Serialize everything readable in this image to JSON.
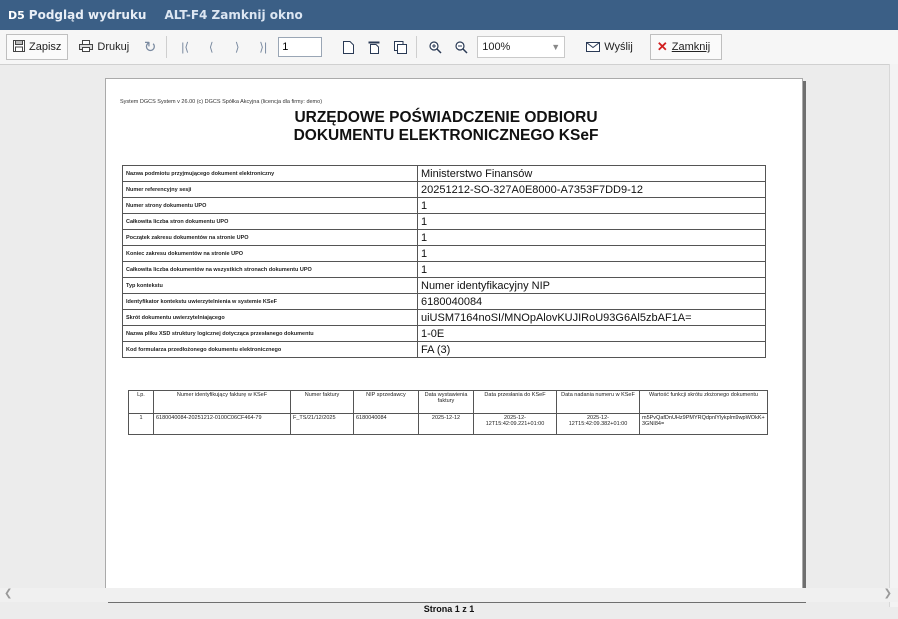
{
  "titlebar": {
    "logo": "D5",
    "title": "Podgląd wydruku",
    "hint": "ALT-F4 Zamknij okno"
  },
  "toolbar": {
    "save_label": "Zapisz",
    "print_label": "Drukuj",
    "page_value": "1",
    "zoom_value": "100%",
    "send_label": "Wyślij",
    "close_label": "Zamknij"
  },
  "document": {
    "system_line": "System DGCS System v 26.00 (c) DGCS Spółka Akcyjna (licencja dla firmy: demo)",
    "title_line1": "URZĘDOWE POŚWIADCZENIE ODBIORU",
    "title_line2": "DOKUMENTU ELEKTRONICZNEGO KSeF",
    "info_rows": [
      {
        "label": "Nazwa podmiotu przyjmującego dokument elektroniczny",
        "value": "Ministerstwo Finansów"
      },
      {
        "label": "Numer referencyjny sesji",
        "value": "20251212-SO-327A0E8000-A7353F7DD9-12"
      },
      {
        "label": "Numer strony dokumentu UPO",
        "value": "1"
      },
      {
        "label": "Całkowita liczba stron dokumentu UPO",
        "value": "1"
      },
      {
        "label": "Początek zakresu dokumentów na stronie UPO",
        "value": "1"
      },
      {
        "label": "Koniec zakresu dokumentów na stronie UPO",
        "value": "1"
      },
      {
        "label": "Całkowita liczba dokumentów na wszystkich stronach dokumentu UPO",
        "value": "1"
      },
      {
        "label": "Typ kontekstu",
        "value": "Numer identyfikacyjny NIP"
      },
      {
        "label": "Identyfikator kontekstu uwierzytelnienia w systemie KSeF",
        "value": "6180040084"
      },
      {
        "label": "Skrót dokumentu uwierzytelniającego",
        "value": "uiUSM7164noSI/MNOpAlovKUJIRoU93G6Al5zbAF1A="
      },
      {
        "label": "Nazwa pliku XSD struktury logicznej dotycząca przesłanego dokumentu",
        "value": "1-0E"
      },
      {
        "label": "Kod formularza przedłożonego dokumentu elektronicznego",
        "value": "FA (3)"
      }
    ],
    "invoice_headers": [
      "Lp.",
      "Numer identyfikujący fakturę w KSeF",
      "Numer faktury",
      "NIP sprzedawcy",
      "Data wystawienia faktury",
      "Data przesłania do KSeF",
      "Data nadania numeru w KSeF",
      "Wartość funkcji skrótu złożonego dokumentu"
    ],
    "invoice_rows": [
      {
        "lp": "1",
        "ksef_id": "6180040084-20251212-0100C06CF464-79",
        "invoice_no": "F_TS/21/12/2025",
        "nip": "6180040084",
        "issue_date": "2025-12-12",
        "sent_date": "2025-12-12T15:42:09.221+01:00",
        "assigned_date": "2025-12-12T15:42:09.382+01:00",
        "hash": "m5PvQafDnUHz9PMYRQdpnlYlykplm9wpWOkK+3GNI84="
      }
    ]
  },
  "footer": {
    "page_info": "Strona 1 z 1"
  }
}
